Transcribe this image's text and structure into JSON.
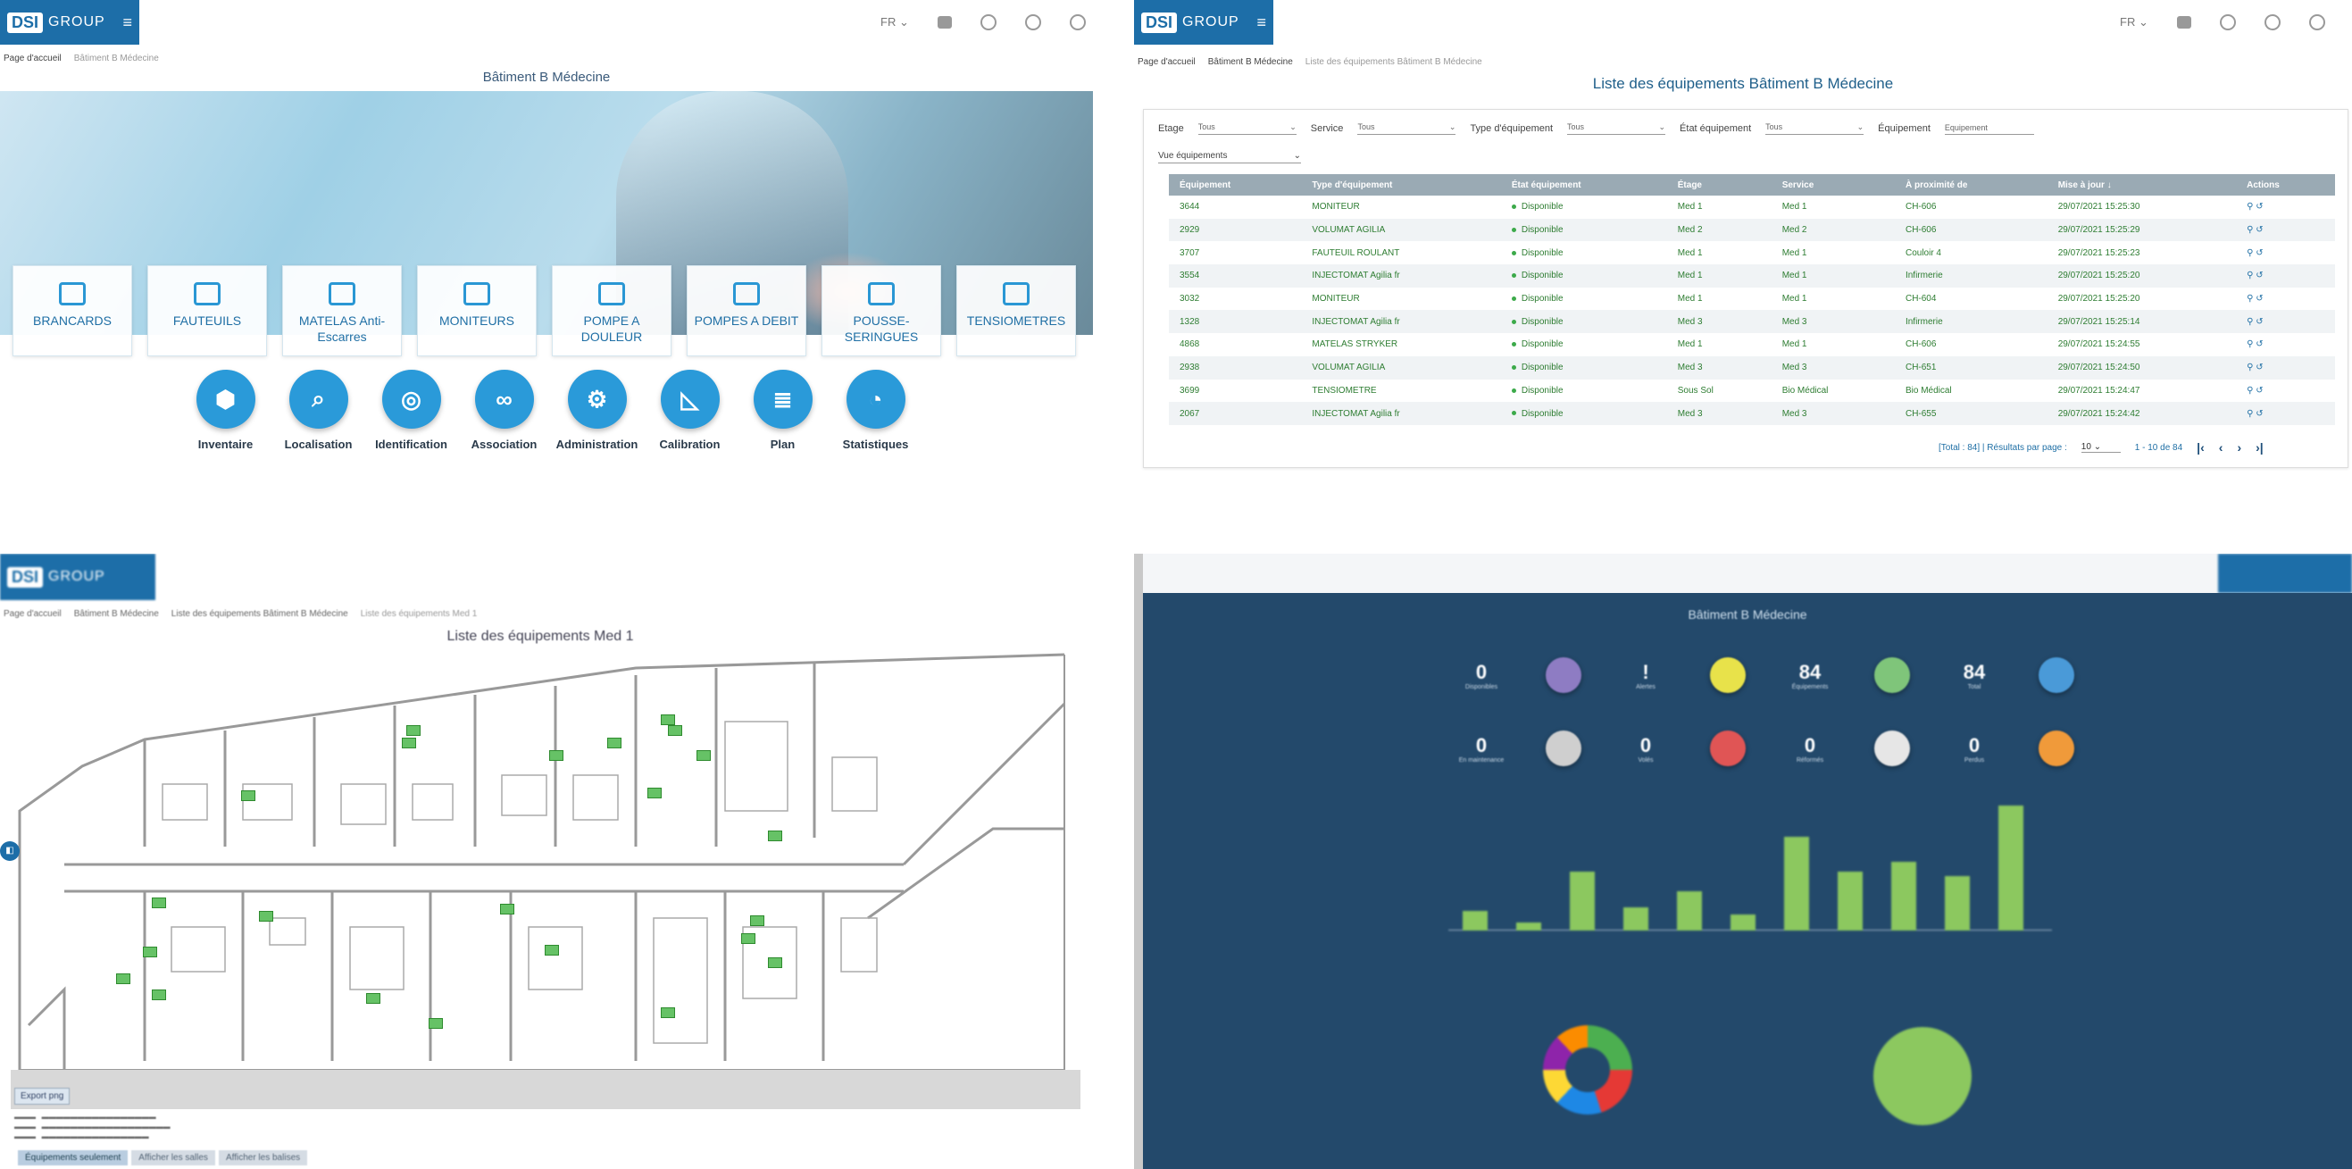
{
  "brand": {
    "logo_dsi": "DSI",
    "logo_group": "GROUP",
    "menu": "≡"
  },
  "topbar": {
    "lang": "FR ⌄"
  },
  "q1": {
    "breadcrumb": [
      "Page d'accueil",
      "Bâtiment B Médecine"
    ],
    "title": "Bâtiment B Médecine",
    "cards": [
      "BRANCARDS",
      "FAUTEUILS",
      "MATELAS Anti-Escarres",
      "MONITEURS",
      "POMPE A DOULEUR",
      "POMPES A DEBIT",
      "POUSSE-SERINGUES",
      "TENSIOMETRES"
    ],
    "apps": [
      {
        "label": "Inventaire",
        "glyph": "⬢"
      },
      {
        "label": "Localisation",
        "glyph": "⌕"
      },
      {
        "label": "Identification",
        "glyph": "◎"
      },
      {
        "label": "Association",
        "glyph": "∞"
      },
      {
        "label": "Administration",
        "glyph": "⚙"
      },
      {
        "label": "Calibration",
        "glyph": "◺"
      },
      {
        "label": "Plan",
        "glyph": "≣"
      },
      {
        "label": "Statistiques",
        "glyph": "◔"
      }
    ]
  },
  "q2": {
    "breadcrumb": [
      "Page d'accueil",
      "Bâtiment B Médecine",
      "Liste des équipements Bâtiment B Médecine"
    ],
    "title": "Liste des équipements Bâtiment B Médecine",
    "filters": [
      {
        "label": "Etage",
        "value": "Tous"
      },
      {
        "label": "Service",
        "value": "Tous"
      },
      {
        "label": "Type d'équipement",
        "value": "Tous"
      },
      {
        "label": "État équipement",
        "value": "Tous"
      },
      {
        "label": "Équipement",
        "value": "Equipement"
      }
    ],
    "view": "Vue équipements",
    "columns": [
      "Équipement",
      "Type d'équipement",
      "État équipement",
      "Étage",
      "Service",
      "À proximité de",
      "Mise à jour ↓",
      "Actions"
    ],
    "rows": [
      [
        "3644",
        "MONITEUR",
        "Disponible",
        "Med 1",
        "Med 1",
        "CH-606",
        "29/07/2021 15:25:30"
      ],
      [
        "2929",
        "VOLUMAT AGILIA",
        "Disponible",
        "Med 2",
        "Med 2",
        "CH-606",
        "29/07/2021 15:25:29"
      ],
      [
        "3707",
        "FAUTEUIL ROULANT",
        "Disponible",
        "Med 1",
        "Med 1",
        "Couloir 4",
        "29/07/2021 15:25:23"
      ],
      [
        "3554",
        "INJECTOMAT Agilia fr",
        "Disponible",
        "Med 1",
        "Med 1",
        "Infirmerie",
        "29/07/2021 15:25:20"
      ],
      [
        "3032",
        "MONITEUR",
        "Disponible",
        "Med 1",
        "Med 1",
        "CH-604",
        "29/07/2021 15:25:20"
      ],
      [
        "1328",
        "INJECTOMAT Agilia fr",
        "Disponible",
        "Med 3",
        "Med 3",
        "Infirmerie",
        "29/07/2021 15:25:14"
      ],
      [
        "4868",
        "MATELAS STRYKER",
        "Disponible",
        "Med 1",
        "Med 1",
        "CH-606",
        "29/07/2021 15:24:55"
      ],
      [
        "2938",
        "VOLUMAT AGILIA",
        "Disponible",
        "Med 3",
        "Med 3",
        "CH-651",
        "29/07/2021 15:24:50"
      ],
      [
        "3699",
        "TENSIOMETRE",
        "Disponible",
        "Sous Sol",
        "Bio Médical",
        "Bio Médical",
        "29/07/2021 15:24:47"
      ],
      [
        "2067",
        "INJECTOMAT Agilia fr",
        "Disponible",
        "Med 3",
        "Med 3",
        "CH-655",
        "29/07/2021 15:24:42"
      ]
    ],
    "actions": "⚲  ↺",
    "pager": {
      "total": "[Total : 84] | Résultats par page :",
      "per_page": "10 ⌄",
      "range": "1 - 10 de 84",
      "first": "|‹",
      "prev": "‹",
      "next": "›",
      "last": "›|"
    }
  },
  "q3": {
    "title": "Liste des équipements Med 1",
    "breadcrumb": [
      "Page d'accueil",
      "Bâtiment B Médecine",
      "Liste des équipements Bâtiment B Médecine",
      "Liste des équipements Med 1"
    ],
    "export_button": "Export png",
    "tabs": [
      "Équipements seulement",
      "Afficher les salles",
      "Afficher les balises"
    ]
  },
  "q4": {
    "title": "Bâtiment B Médecine",
    "kpis_row1": [
      {
        "n": "0",
        "l": "Disponibles",
        "color": ""
      },
      {
        "n": "",
        "l": "",
        "color": "#8e7cc3"
      },
      {
        "n": "!",
        "l": "Alertes",
        "color": ""
      },
      {
        "n": "",
        "l": "",
        "color": "#e8e24a"
      },
      {
        "n": "84",
        "l": "Équipements",
        "color": ""
      },
      {
        "n": "",
        "l": "",
        "color": "#7fc57a"
      },
      {
        "n": "84",
        "l": "Total",
        "color": ""
      },
      {
        "n": "",
        "l": "",
        "color": "#4a9ad8"
      }
    ],
    "kpis_row2": [
      {
        "n": "0",
        "l": "En maintenance",
        "color": ""
      },
      {
        "n": "",
        "l": "",
        "color": "#cfcfcf"
      },
      {
        "n": "0",
        "l": "Volés",
        "color": ""
      },
      {
        "n": "",
        "l": "",
        "color": "#e05555"
      },
      {
        "n": "0",
        "l": "Réformés",
        "color": ""
      },
      {
        "n": "",
        "l": "",
        "color": "#e6e6e6"
      },
      {
        "n": "0",
        "l": "Perdus",
        "color": ""
      },
      {
        "n": "",
        "l": "",
        "color": "#f09a3a"
      }
    ],
    "bar_values": [
      10,
      4,
      30,
      12,
      20,
      8,
      48,
      30,
      35,
      28,
      64
    ],
    "bar_color": "#8cc85f"
  }
}
